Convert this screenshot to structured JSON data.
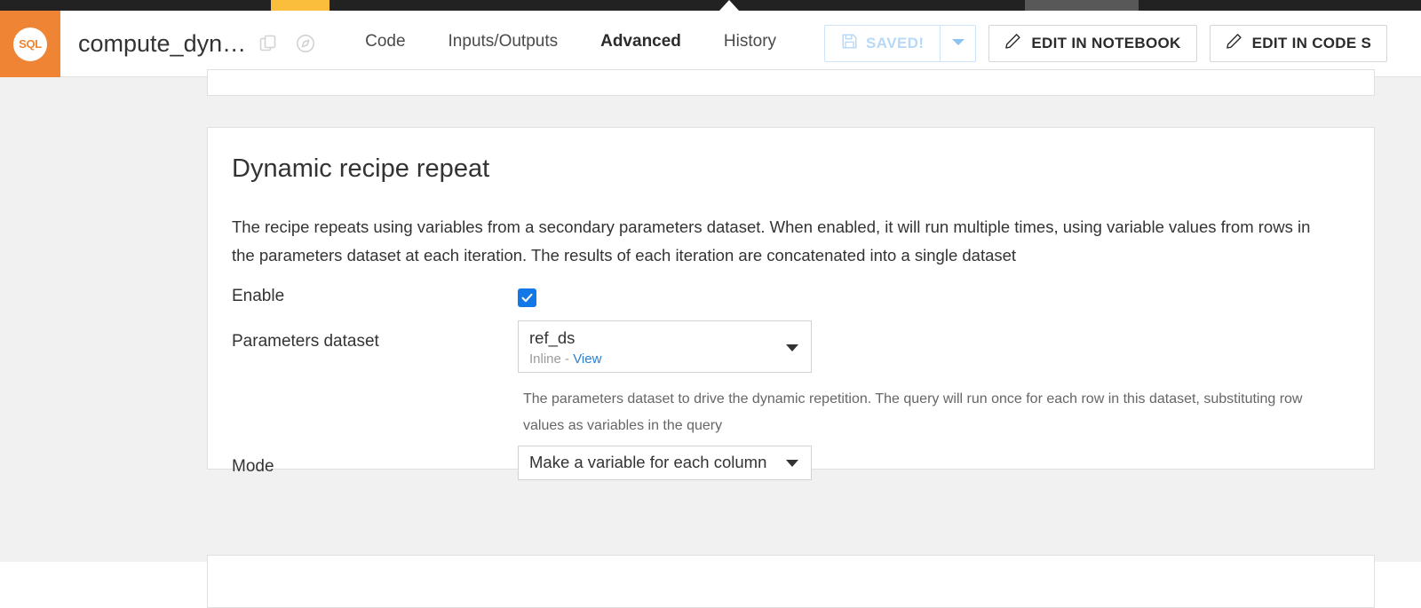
{
  "window": {
    "strip_color_dark": "#222222",
    "strip_color_amber": "#fbbe3c",
    "strip_color_gray": "#585858"
  },
  "header": {
    "recipe_type": "SQL",
    "title": "compute_dyn…",
    "icons": [
      {
        "name": "duplicate-icon"
      },
      {
        "name": "compass-icon"
      }
    ],
    "tabs": [
      {
        "label": "Code",
        "active": false
      },
      {
        "label": "Inputs/Outputs",
        "active": false
      },
      {
        "label": "Advanced",
        "active": true
      },
      {
        "label": "History",
        "active": false
      }
    ],
    "save": {
      "label": "SAVED!",
      "icon": "floppy-disk-icon",
      "dropdown_icon": "caret-down-icon",
      "accent": "#b7d8f7"
    },
    "actions": [
      {
        "label": "EDIT IN NOTEBOOK",
        "icon": "pencil-icon"
      },
      {
        "label": "EDIT IN CODE S",
        "icon": "pencil-icon"
      }
    ]
  },
  "main": {
    "section_title": "Dynamic recipe repeat",
    "description": "The recipe repeats using variables from a secondary parameters dataset. When enabled, it will run multiple times, using variable values from rows in the parameters dataset at each iteration. The results of each iteration are concatenated into a single dataset",
    "fields": {
      "enable": {
        "label": "Enable",
        "checked": true,
        "accent": "#1278e8"
      },
      "parameters_dataset": {
        "label": "Parameters dataset",
        "value": "ref_ds",
        "sub_prefix": "Inline - ",
        "sub_link": "View",
        "help": "The parameters dataset to drive the dynamic repetition. The query will run once for each row in this dataset, substituting row values as variables in the query"
      },
      "mode": {
        "label": "Mode",
        "value": "Make a variable for each column"
      }
    }
  }
}
